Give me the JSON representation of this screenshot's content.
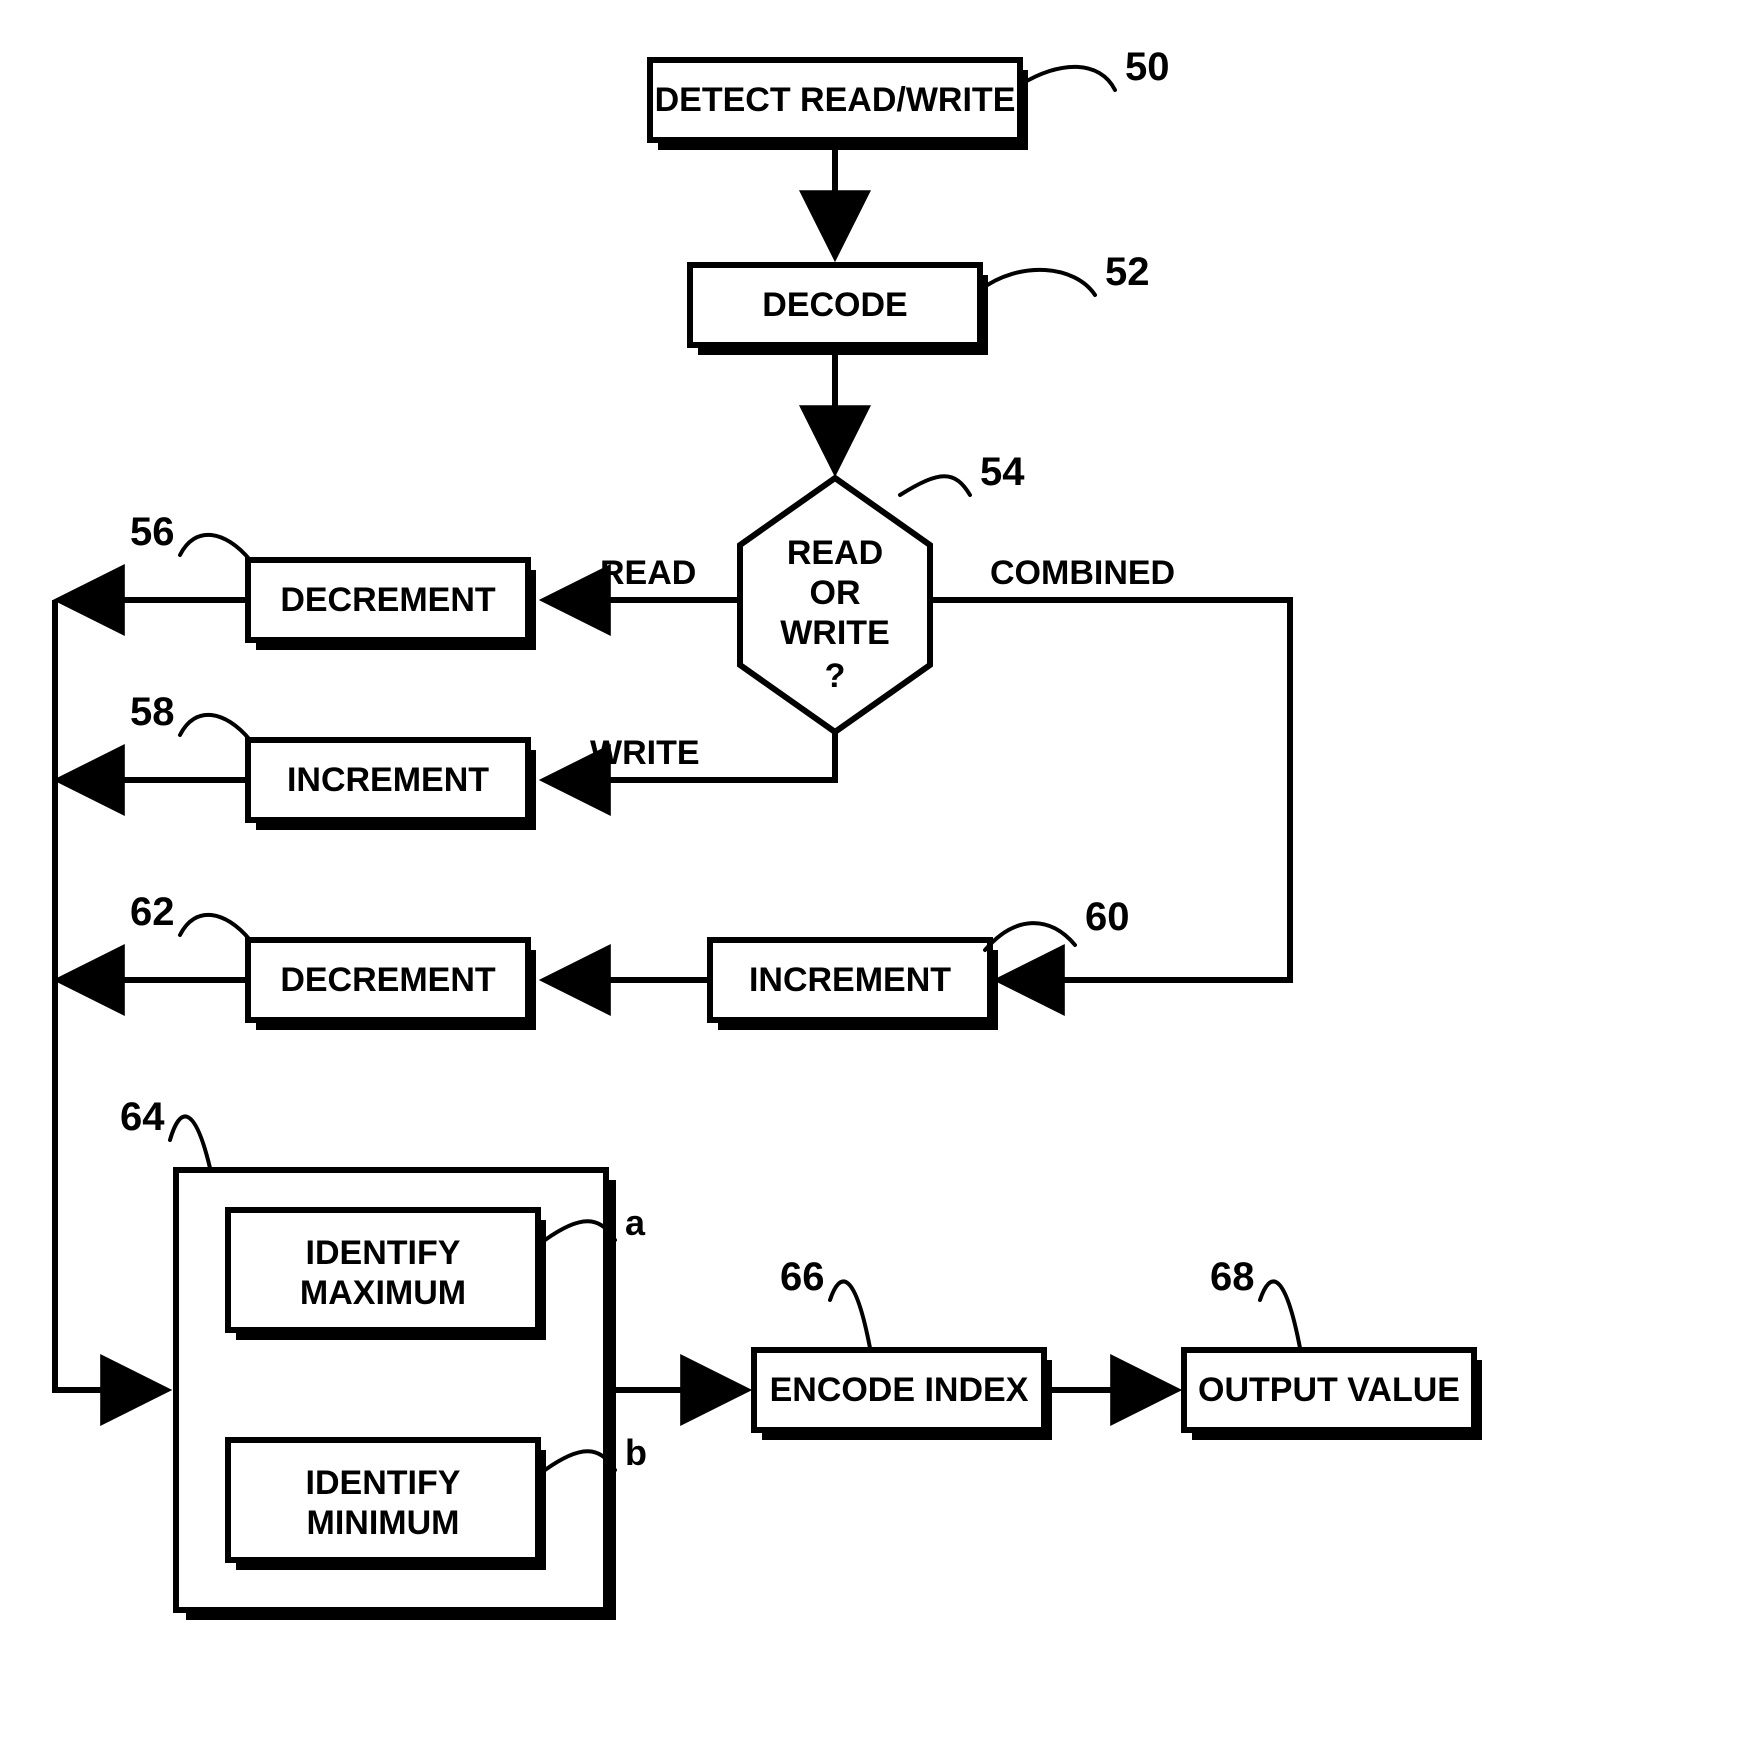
{
  "chart_data": {
    "type": "flowchart",
    "nodes": [
      {
        "id": "detect",
        "ref": "50",
        "label": "DETECT READ/WRITE",
        "shape": "process"
      },
      {
        "id": "decode",
        "ref": "52",
        "label": "DECODE",
        "shape": "process"
      },
      {
        "id": "decision",
        "ref": "54",
        "label": "READ OR WRITE ?",
        "shape": "decision"
      },
      {
        "id": "dec56",
        "ref": "56",
        "label": "DECREMENT",
        "shape": "process"
      },
      {
        "id": "inc58",
        "ref": "58",
        "label": "INCREMENT",
        "shape": "process"
      },
      {
        "id": "inc60",
        "ref": "60",
        "label": "INCREMENT",
        "shape": "process"
      },
      {
        "id": "dec62",
        "ref": "62",
        "label": "DECREMENT",
        "shape": "process"
      },
      {
        "id": "identify",
        "ref": "64",
        "label": "",
        "shape": "group",
        "children": [
          {
            "id": "idmax",
            "ref": "a",
            "label": "IDENTIFY MAXIMUM"
          },
          {
            "id": "idmin",
            "ref": "b",
            "label": "IDENTIFY MINIMUM"
          }
        ]
      },
      {
        "id": "encode",
        "ref": "66",
        "label": "ENCODE INDEX",
        "shape": "process"
      },
      {
        "id": "output",
        "ref": "68",
        "label": "OUTPUT VALUE",
        "shape": "process"
      }
    ],
    "edges": [
      {
        "from": "detect",
        "to": "decode"
      },
      {
        "from": "decode",
        "to": "decision"
      },
      {
        "from": "decision",
        "to": "dec56",
        "label": "READ"
      },
      {
        "from": "decision",
        "to": "inc58",
        "label": "WRITE"
      },
      {
        "from": "decision",
        "to": "inc60",
        "label": "COMBINED"
      },
      {
        "from": "inc60",
        "to": "dec62"
      },
      {
        "from": "dec56",
        "to": "identify"
      },
      {
        "from": "inc58",
        "to": "identify"
      },
      {
        "from": "dec62",
        "to": "identify"
      },
      {
        "from": "identify",
        "to": "encode"
      },
      {
        "from": "encode",
        "to": "output"
      }
    ]
  },
  "labels": {
    "detect": "DETECT READ/WRITE",
    "decode": "DECODE",
    "decision_l1": "READ",
    "decision_l2": "OR",
    "decision_l3": "WRITE",
    "decision_l4": "?",
    "dec56": "DECREMENT",
    "inc58": "INCREMENT",
    "inc60": "INCREMENT",
    "dec62": "DECREMENT",
    "idmax_l1": "IDENTIFY",
    "idmax_l2": "MAXIMUM",
    "idmin_l1": "IDENTIFY",
    "idmin_l2": "MINIMUM",
    "encode": "ENCODE INDEX",
    "output": "OUTPUT VALUE",
    "edge_read": "READ",
    "edge_write": "WRITE",
    "edge_combined": "COMBINED",
    "sub_a": "a",
    "sub_b": "b"
  },
  "refs": {
    "r50": "50",
    "r52": "52",
    "r54": "54",
    "r56": "56",
    "r58": "58",
    "r60": "60",
    "r62": "62",
    "r64": "64",
    "r66": "66",
    "r68": "68"
  }
}
